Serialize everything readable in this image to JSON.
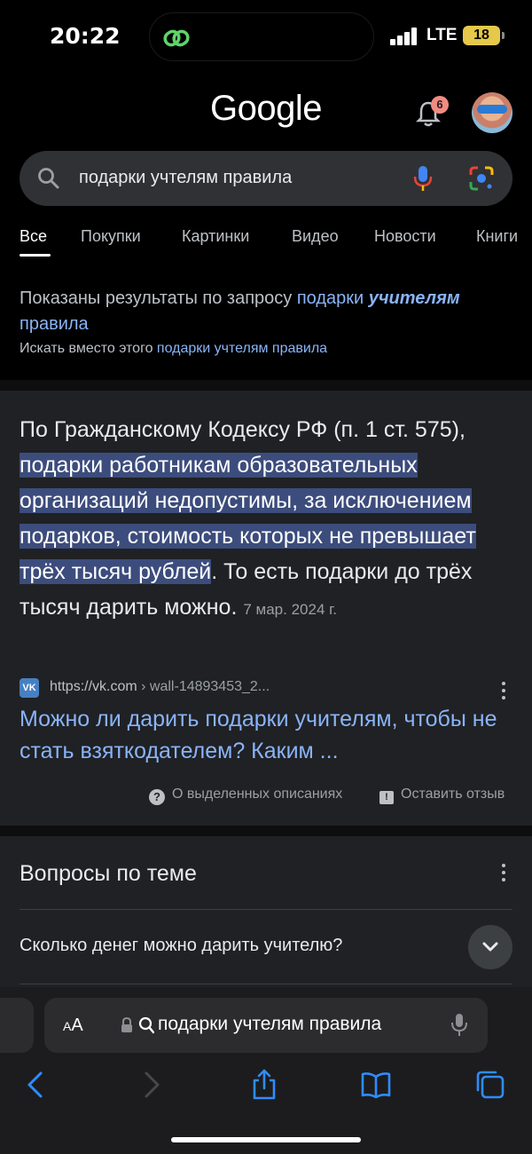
{
  "status_bar": {
    "time": "20:22",
    "network": "LTE",
    "battery": "18"
  },
  "header": {
    "logo": "Google",
    "notification_count": "6"
  },
  "search": {
    "query": "подарки учтелям правила"
  },
  "tabs": [
    "Все",
    "Покупки",
    "Картинки",
    "Видео",
    "Новости",
    "Книги"
  ],
  "correction": {
    "prefix": "Показаны результаты по запросу ",
    "query_link_start": "подарки",
    "query_link_emph": "учителям",
    "query_link_end": "правила",
    "alt_prefix": "Искать вместо этого ",
    "alt_link": "подарки учтелям правила"
  },
  "featured_snippet": {
    "intro": "По Гражданскому Кодексу РФ (п. 1 ст. 575), ",
    "highlight": "подарки работникам образовательных организаций недопустимы, за исключением подарков, стоимость которых не превышает трёх тысяч рублей",
    "rest": ". То есть подарки до трёх тысяч дарить можно.",
    "date": "7 мар. 2024 г.",
    "source_domain": "https://vk.com",
    "source_path": " › wall-14893453_2...",
    "source_icon": "VK",
    "result_title": "Можно ли дарить подарки учителям, чтобы не стать взяткодателем? Каким ...",
    "about_label": "О выделенных описаниях",
    "feedback_label": "Оставить отзыв"
  },
  "related_questions": {
    "title": "Вопросы по теме",
    "items": [
      "Сколько денег можно дарить учителю?"
    ]
  },
  "browser_toolbar": {
    "aa_large": "A",
    "aa_small": "A",
    "address_text": "подарки учтелям правила"
  },
  "colors": {
    "background": "#202124",
    "link": "#8ab4f8",
    "highlight": "#3c4c7c"
  },
  "icons": [
    "search-icon",
    "mic-icon",
    "lens-icon",
    "bell-icon",
    "vk-icon",
    "kebab-icon",
    "chevron-down-icon",
    "back-icon",
    "forward-icon",
    "share-icon",
    "bookmarks-icon",
    "tabs-icon"
  ]
}
